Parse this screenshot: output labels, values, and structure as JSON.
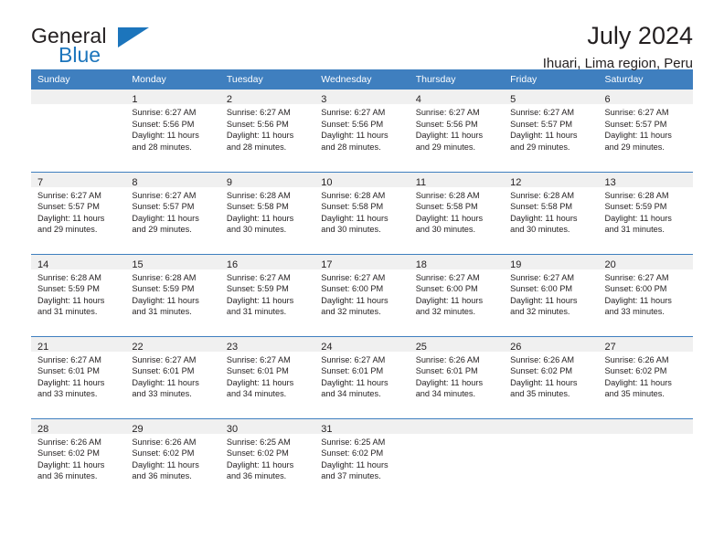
{
  "brand": {
    "name_part1": "General",
    "name_part2": "Blue",
    "accent_color": "#1c75bc"
  },
  "header": {
    "title": "July 2024",
    "subtitle": "Ihuari, Lima region, Peru"
  },
  "theme": {
    "header_row_bg": "#3f7fbf",
    "daynum_band_bg": "#f0f0f0",
    "text_color": "#231f20"
  },
  "weekday_headers": [
    "Sunday",
    "Monday",
    "Tuesday",
    "Wednesday",
    "Thursday",
    "Friday",
    "Saturday"
  ],
  "weeks": [
    [
      {
        "day": ""
      },
      {
        "day": "1",
        "sunrise": "Sunrise: 6:27 AM",
        "sunset": "Sunset: 5:56 PM",
        "daylight1": "Daylight: 11 hours",
        "daylight2": "and 28 minutes."
      },
      {
        "day": "2",
        "sunrise": "Sunrise: 6:27 AM",
        "sunset": "Sunset: 5:56 PM",
        "daylight1": "Daylight: 11 hours",
        "daylight2": "and 28 minutes."
      },
      {
        "day": "3",
        "sunrise": "Sunrise: 6:27 AM",
        "sunset": "Sunset: 5:56 PM",
        "daylight1": "Daylight: 11 hours",
        "daylight2": "and 28 minutes."
      },
      {
        "day": "4",
        "sunrise": "Sunrise: 6:27 AM",
        "sunset": "Sunset: 5:56 PM",
        "daylight1": "Daylight: 11 hours",
        "daylight2": "and 29 minutes."
      },
      {
        "day": "5",
        "sunrise": "Sunrise: 6:27 AM",
        "sunset": "Sunset: 5:57 PM",
        "daylight1": "Daylight: 11 hours",
        "daylight2": "and 29 minutes."
      },
      {
        "day": "6",
        "sunrise": "Sunrise: 6:27 AM",
        "sunset": "Sunset: 5:57 PM",
        "daylight1": "Daylight: 11 hours",
        "daylight2": "and 29 minutes."
      }
    ],
    [
      {
        "day": "7",
        "sunrise": "Sunrise: 6:27 AM",
        "sunset": "Sunset: 5:57 PM",
        "daylight1": "Daylight: 11 hours",
        "daylight2": "and 29 minutes."
      },
      {
        "day": "8",
        "sunrise": "Sunrise: 6:27 AM",
        "sunset": "Sunset: 5:57 PM",
        "daylight1": "Daylight: 11 hours",
        "daylight2": "and 29 minutes."
      },
      {
        "day": "9",
        "sunrise": "Sunrise: 6:28 AM",
        "sunset": "Sunset: 5:58 PM",
        "daylight1": "Daylight: 11 hours",
        "daylight2": "and 30 minutes."
      },
      {
        "day": "10",
        "sunrise": "Sunrise: 6:28 AM",
        "sunset": "Sunset: 5:58 PM",
        "daylight1": "Daylight: 11 hours",
        "daylight2": "and 30 minutes."
      },
      {
        "day": "11",
        "sunrise": "Sunrise: 6:28 AM",
        "sunset": "Sunset: 5:58 PM",
        "daylight1": "Daylight: 11 hours",
        "daylight2": "and 30 minutes."
      },
      {
        "day": "12",
        "sunrise": "Sunrise: 6:28 AM",
        "sunset": "Sunset: 5:58 PM",
        "daylight1": "Daylight: 11 hours",
        "daylight2": "and 30 minutes."
      },
      {
        "day": "13",
        "sunrise": "Sunrise: 6:28 AM",
        "sunset": "Sunset: 5:59 PM",
        "daylight1": "Daylight: 11 hours",
        "daylight2": "and 31 minutes."
      }
    ],
    [
      {
        "day": "14",
        "sunrise": "Sunrise: 6:28 AM",
        "sunset": "Sunset: 5:59 PM",
        "daylight1": "Daylight: 11 hours",
        "daylight2": "and 31 minutes."
      },
      {
        "day": "15",
        "sunrise": "Sunrise: 6:28 AM",
        "sunset": "Sunset: 5:59 PM",
        "daylight1": "Daylight: 11 hours",
        "daylight2": "and 31 minutes."
      },
      {
        "day": "16",
        "sunrise": "Sunrise: 6:27 AM",
        "sunset": "Sunset: 5:59 PM",
        "daylight1": "Daylight: 11 hours",
        "daylight2": "and 31 minutes."
      },
      {
        "day": "17",
        "sunrise": "Sunrise: 6:27 AM",
        "sunset": "Sunset: 6:00 PM",
        "daylight1": "Daylight: 11 hours",
        "daylight2": "and 32 minutes."
      },
      {
        "day": "18",
        "sunrise": "Sunrise: 6:27 AM",
        "sunset": "Sunset: 6:00 PM",
        "daylight1": "Daylight: 11 hours",
        "daylight2": "and 32 minutes."
      },
      {
        "day": "19",
        "sunrise": "Sunrise: 6:27 AM",
        "sunset": "Sunset: 6:00 PM",
        "daylight1": "Daylight: 11 hours",
        "daylight2": "and 32 minutes."
      },
      {
        "day": "20",
        "sunrise": "Sunrise: 6:27 AM",
        "sunset": "Sunset: 6:00 PM",
        "daylight1": "Daylight: 11 hours",
        "daylight2": "and 33 minutes."
      }
    ],
    [
      {
        "day": "21",
        "sunrise": "Sunrise: 6:27 AM",
        "sunset": "Sunset: 6:01 PM",
        "daylight1": "Daylight: 11 hours",
        "daylight2": "and 33 minutes."
      },
      {
        "day": "22",
        "sunrise": "Sunrise: 6:27 AM",
        "sunset": "Sunset: 6:01 PM",
        "daylight1": "Daylight: 11 hours",
        "daylight2": "and 33 minutes."
      },
      {
        "day": "23",
        "sunrise": "Sunrise: 6:27 AM",
        "sunset": "Sunset: 6:01 PM",
        "daylight1": "Daylight: 11 hours",
        "daylight2": "and 34 minutes."
      },
      {
        "day": "24",
        "sunrise": "Sunrise: 6:27 AM",
        "sunset": "Sunset: 6:01 PM",
        "daylight1": "Daylight: 11 hours",
        "daylight2": "and 34 minutes."
      },
      {
        "day": "25",
        "sunrise": "Sunrise: 6:26 AM",
        "sunset": "Sunset: 6:01 PM",
        "daylight1": "Daylight: 11 hours",
        "daylight2": "and 34 minutes."
      },
      {
        "day": "26",
        "sunrise": "Sunrise: 6:26 AM",
        "sunset": "Sunset: 6:02 PM",
        "daylight1": "Daylight: 11 hours",
        "daylight2": "and 35 minutes."
      },
      {
        "day": "27",
        "sunrise": "Sunrise: 6:26 AM",
        "sunset": "Sunset: 6:02 PM",
        "daylight1": "Daylight: 11 hours",
        "daylight2": "and 35 minutes."
      }
    ],
    [
      {
        "day": "28",
        "sunrise": "Sunrise: 6:26 AM",
        "sunset": "Sunset: 6:02 PM",
        "daylight1": "Daylight: 11 hours",
        "daylight2": "and 36 minutes."
      },
      {
        "day": "29",
        "sunrise": "Sunrise: 6:26 AM",
        "sunset": "Sunset: 6:02 PM",
        "daylight1": "Daylight: 11 hours",
        "daylight2": "and 36 minutes."
      },
      {
        "day": "30",
        "sunrise": "Sunrise: 6:25 AM",
        "sunset": "Sunset: 6:02 PM",
        "daylight1": "Daylight: 11 hours",
        "daylight2": "and 36 minutes."
      },
      {
        "day": "31",
        "sunrise": "Sunrise: 6:25 AM",
        "sunset": "Sunset: 6:02 PM",
        "daylight1": "Daylight: 11 hours",
        "daylight2": "and 37 minutes."
      },
      {
        "day": ""
      },
      {
        "day": ""
      },
      {
        "day": ""
      }
    ]
  ]
}
